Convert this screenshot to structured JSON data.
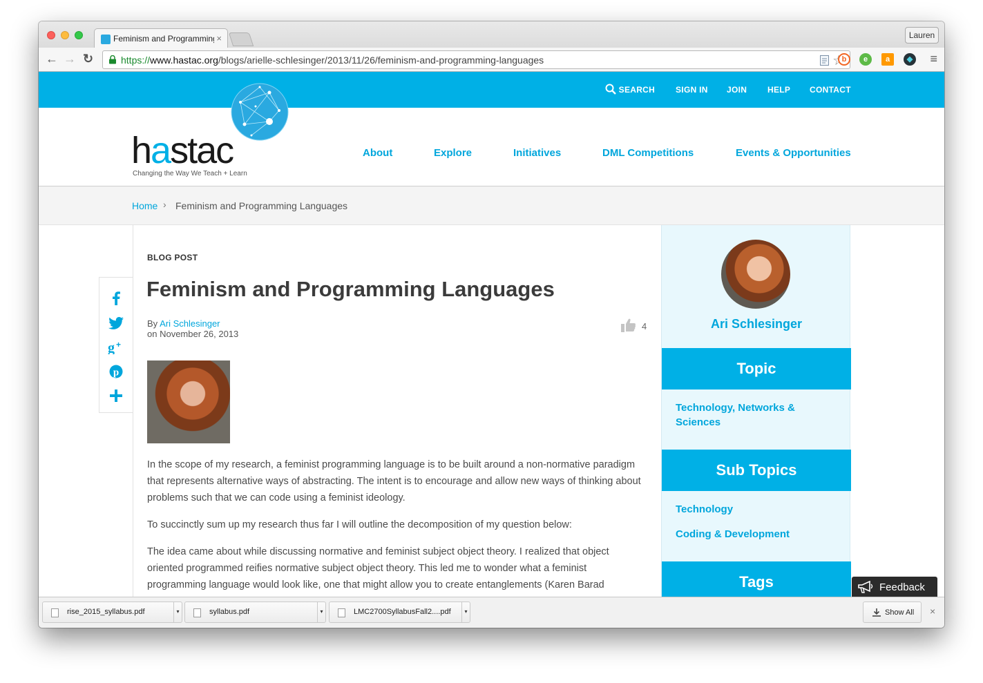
{
  "browser": {
    "tab_title": "Feminism and Programming Languages",
    "tab_close": "×",
    "profile_name": "Lauren",
    "url_scheme": "https://",
    "url_host": "www.hastac.org",
    "url_path": "/blogs/arielle-schlesinger/2013/11/26/feminism-and-programming-languages",
    "nav_back": "←",
    "nav_forward": "→",
    "nav_reload": "↻",
    "bookmark_star": "☆",
    "menu_glyph": "≡"
  },
  "utility_nav": {
    "search": "SEARCH",
    "sign_in": "SIGN IN",
    "join": "JOIN",
    "help": "HELP",
    "contact": "CONTACT"
  },
  "brand": {
    "wordmark_pre": "h",
    "wordmark_accent": "a",
    "wordmark_post": "stac",
    "tagline": "Changing the Way We Teach + Learn"
  },
  "main_nav": [
    "About",
    "Explore",
    "Initiatives",
    "DML Competitions",
    "Events & Opportunities"
  ],
  "breadcrumb": {
    "home": "Home",
    "separator": "›",
    "current": "Feminism and Programming Languages"
  },
  "article": {
    "kicker": "BLOG POST",
    "title": "Feminism and Programming Languages",
    "by_prefix": "By",
    "author": "Ari Schlesinger",
    "date_line": "on November 26, 2013",
    "likes": "4",
    "paragraphs": [
      "In the scope of my research, a feminist programming language is to be built around a non-normative paradigm that represents alternative ways of abstracting. The intent is to encourage and allow new ways of thinking about problems such that we can code using a feminist ideology.",
      "To succinctly sum up my research thus far I will outline the decomposition of my question below:",
      "The idea came about while discussing normative and feminist subject object theory. I realized that object oriented programmed reifies normative subject object theory. This led me to wonder what a feminist programming language would look like, one that might allow you to create entanglements (Karen Barad"
    ]
  },
  "sidebar": {
    "author_name": "Ari Schlesinger",
    "topic_heading": "Topic",
    "topic_link": "Technology, Networks & Sciences",
    "subtopics_heading": "Sub Topics",
    "subtopics": [
      "Technology",
      "Coding & Development"
    ],
    "tags_heading": "Tags"
  },
  "feedback": {
    "label": "Feedback"
  },
  "downloads": {
    "items": [
      "rise_2015_syllabus.pdf",
      "syllabus.pdf",
      "LMC2700SyllabusFall2....pdf"
    ],
    "dropdown_glyph": "▾",
    "show_all": "Show All",
    "close": "×"
  },
  "colors": {
    "brand_blue": "#00b0e6",
    "link_blue": "#00a6dc",
    "sidebar_bg": "#e8f8fd"
  }
}
